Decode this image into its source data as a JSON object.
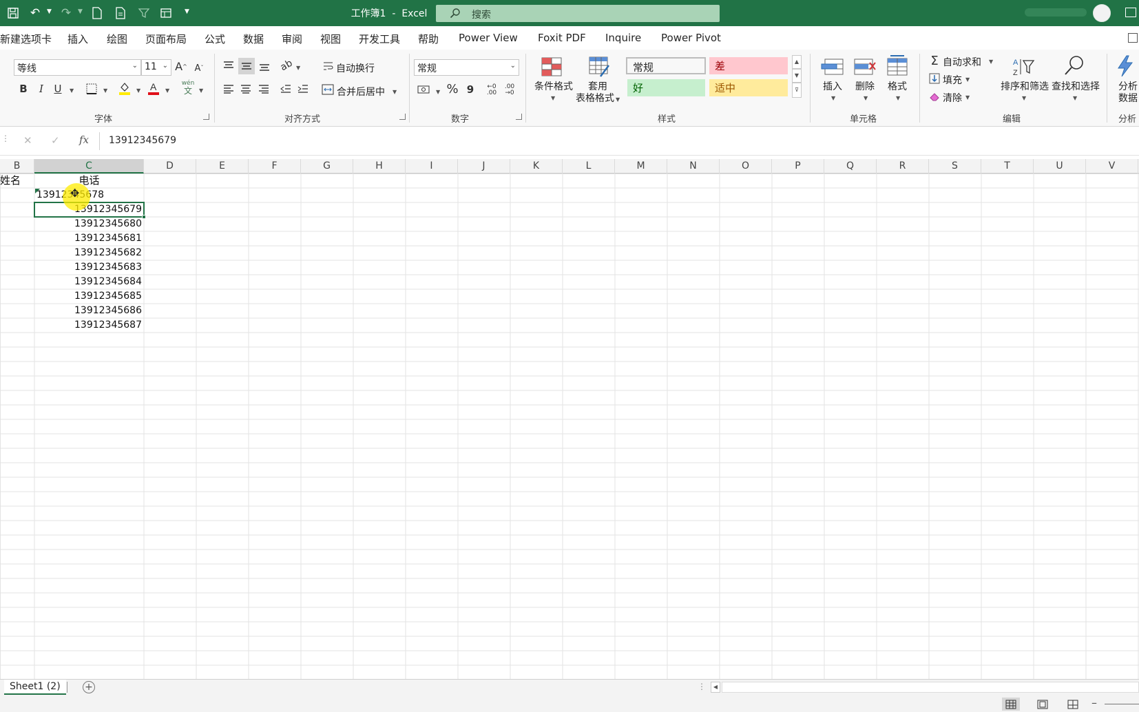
{
  "window": {
    "title": "工作簿1  -  Excel",
    "search_label": "搜索"
  },
  "tabs": [
    "新建选项卡",
    "插入",
    "绘图",
    "页面布局",
    "公式",
    "数据",
    "审阅",
    "视图",
    "开发工具",
    "帮助",
    "Power View",
    "Foxit PDF",
    "Inquire",
    "Power Pivot"
  ],
  "ribbon": {
    "font": {
      "group_label": "字体",
      "font_name": "等线",
      "font_size": "11",
      "bold": "B",
      "italic": "I",
      "underline": "U",
      "phonetic_top": "wén",
      "phonetic_bottom": "文"
    },
    "alignment": {
      "group_label": "对齐方式",
      "wrap_text": "自动换行",
      "merge_center": "合并后居中"
    },
    "number": {
      "group_label": "数字",
      "format": "常规",
      "percent": "%",
      "comma": "9",
      "inc_decimal": "←0 .00",
      "dec_decimal": ".00 →0"
    },
    "styles": {
      "group_label": "样式",
      "conditional_format": "条件格式",
      "format_as_table_1": "套用",
      "format_as_table_2": "表格格式",
      "cell_styles": [
        {
          "label": "常规",
          "bg": "#ffffff",
          "fg": "#000000"
        },
        {
          "label": "差",
          "bg": "#ffc7ce",
          "fg": "#9c0006"
        },
        {
          "label": "好",
          "bg": "#c6efce",
          "fg": "#006100"
        },
        {
          "label": "适中",
          "bg": "#ffeb9c",
          "fg": "#9c5700"
        }
      ]
    },
    "cells": {
      "group_label": "单元格",
      "insert": "插入",
      "delete": "删除",
      "format": "格式"
    },
    "editing": {
      "group_label": "编辑",
      "autosum": "自动求和",
      "fill": "填充",
      "clear": "清除",
      "sort_filter": "排序和筛选",
      "find_select": "查找和选择"
    },
    "analysis": {
      "group_label": "分析",
      "analyze_data_1": "分析",
      "analyze_data_2": "数据"
    }
  },
  "formula_bar": {
    "fx": "fx",
    "value": "13912345679"
  },
  "sheet": {
    "columns": [
      "B",
      "C",
      "D",
      "E",
      "F",
      "G",
      "H",
      "I",
      "J",
      "K",
      "L",
      "M",
      "N",
      "O",
      "P",
      "Q",
      "R",
      "S",
      "T",
      "U",
      "V"
    ],
    "selected_column": "C",
    "b_header": "姓名",
    "c_header": "电话",
    "first_value": "13912345678",
    "values": [
      "13912345679",
      "13912345680",
      "13912345681",
      "13912345682",
      "13912345683",
      "13912345684",
      "13912345685",
      "13912345686",
      "13912345687"
    ]
  },
  "sheet_tabs": {
    "active": "Sheet1 (2)",
    "add": "+"
  },
  "accent_color": "#217346"
}
